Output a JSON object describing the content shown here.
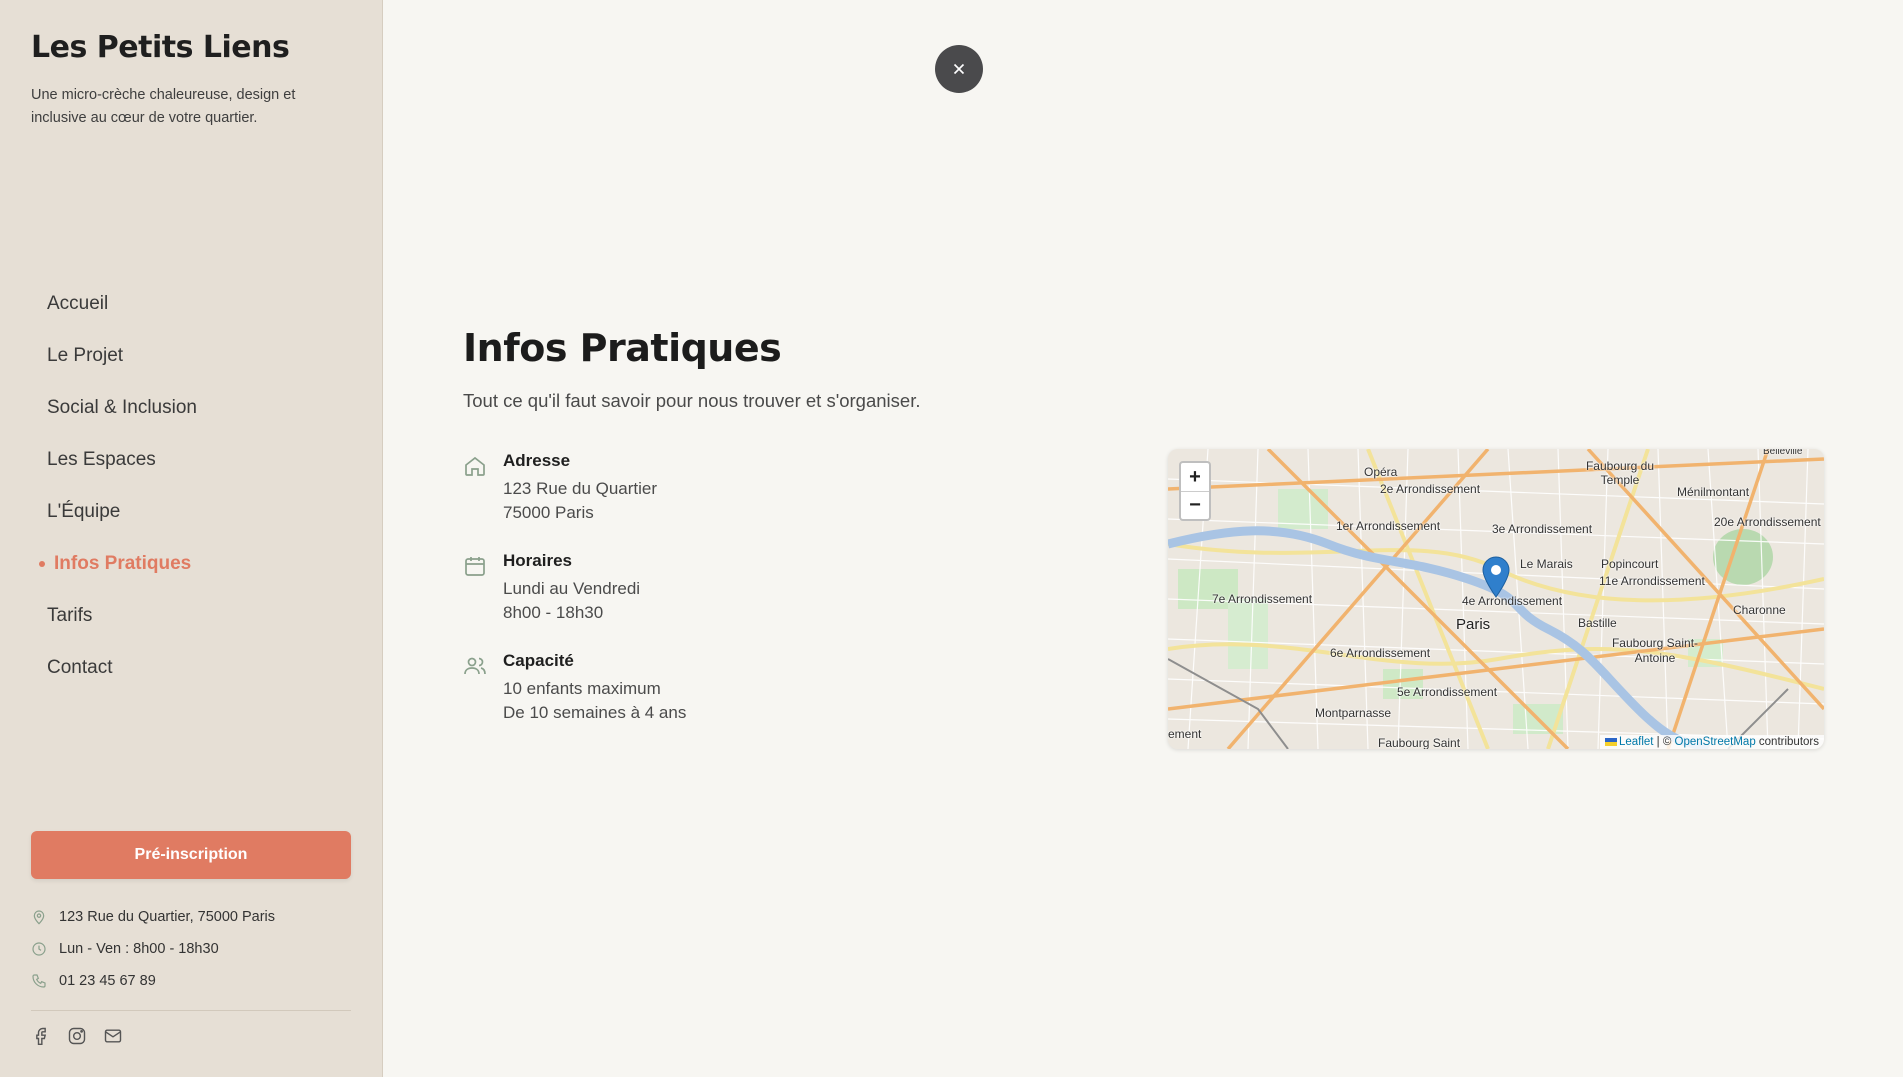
{
  "brand": {
    "title": "Les Petits Liens",
    "tagline": "Une micro-crèche chaleureuse, design et inclusive au cœur de votre quartier."
  },
  "nav": {
    "items": [
      {
        "label": "Accueil"
      },
      {
        "label": "Le Projet"
      },
      {
        "label": "Social & Inclusion"
      },
      {
        "label": "Les Espaces"
      },
      {
        "label": "L'Équipe"
      },
      {
        "label": "Infos Pratiques",
        "active": true
      },
      {
        "label": "Tarifs"
      },
      {
        "label": "Contact"
      }
    ]
  },
  "sidebar": {
    "cta_label": "Pré-inscription",
    "contact": {
      "address": "123 Rue du Quartier, 75000 Paris",
      "hours": "Lun - Ven : 8h00 - 18h30",
      "phone": "01 23 45 67 89"
    }
  },
  "main": {
    "title": "Infos Pratiques",
    "subtitle": "Tout ce qu'il faut savoir pour nous trouver et s'organiser.",
    "address": {
      "title": "Adresse",
      "line1": "123 Rue du Quartier",
      "line2": "75000 Paris"
    },
    "hours": {
      "title": "Horaires",
      "line1": "Lundi au Vendredi",
      "line2": "8h00 - 18h30"
    },
    "capacity": {
      "title": "Capacité",
      "line1": "10 enfants maximum",
      "line2": "De 10 semaines à 4 ans"
    }
  },
  "map": {
    "zoom_in": "+",
    "zoom_out": "−",
    "attribution_leaflet": "Leaflet",
    "attribution_sep": " | © ",
    "attribution_osm": "OpenStreetMap",
    "attribution_tail": " contributors",
    "labels": {
      "opera": "Opéra",
      "faubourg_temple": "Faubourg du Temple",
      "belleville": "Belleville",
      "menilmontant": "Ménilmontant",
      "arr2": "2e Arrondissement",
      "arr1": "1er Arrondissement",
      "arr3": "3e Arrondissement",
      "arr20": "20e Arrondissement",
      "marais": "Le Marais",
      "popincourt": "Popincourt",
      "arr11": "11e Arrondissement",
      "arr7": "7e Arrondissement",
      "arr4": "4e Arrondissement",
      "paris": "Paris",
      "charonne": "Charonne",
      "bastille": "Bastille",
      "arr6": "6e Arrondissement",
      "fb_antoine": "Faubourg Saint-Antoine",
      "arr5": "5e Arrondissement",
      "montparnasse": "Montparnasse",
      "ement": "ement",
      "fb_saint": "Faubourg Saint"
    }
  },
  "colors": {
    "accent": "#e07b62",
    "sidebar_bg": "#e6dfd5",
    "page_bg": "#f7f6f2",
    "icon_green": "#8aa08c"
  }
}
